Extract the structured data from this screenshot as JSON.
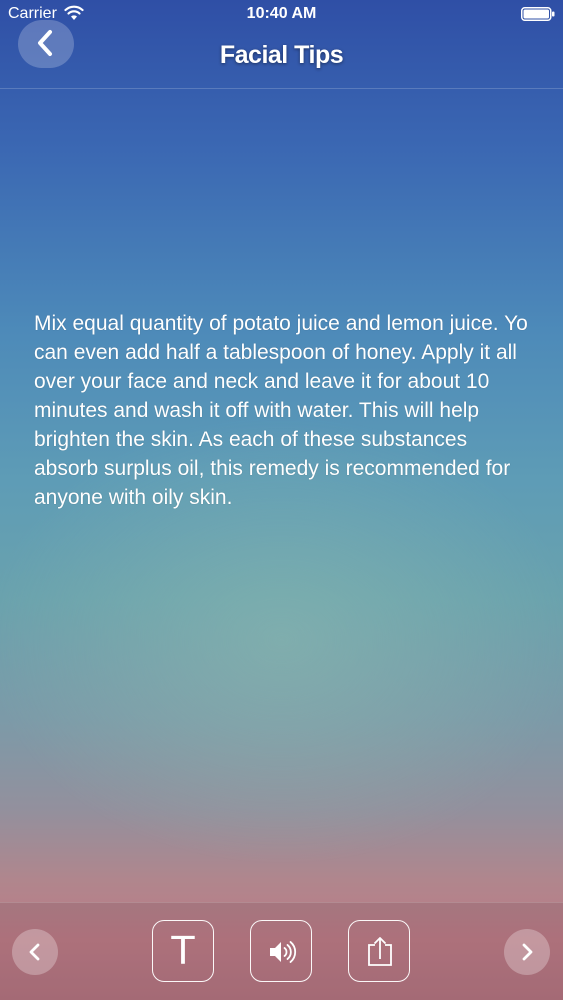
{
  "status_bar": {
    "carrier": "Carrier",
    "time": "10:40 AM",
    "wifi_icon": "wifi-icon",
    "battery_icon": "battery-full-icon"
  },
  "nav": {
    "title": "Facial Tips",
    "back_icon": "chevron-left-icon"
  },
  "content": {
    "tip": "Mix equal quantity of potato juice and lemon juice. Yo can even add half a tablespoon of honey. Apply it all over your face and neck and leave it for about 10 minutes and wash it off with water. This will help brighten the skin. As each of these substances absorb surplus oil, this remedy is recommended for anyone with oily skin."
  },
  "toolbar": {
    "prev_icon": "chevron-left-icon",
    "text_size_glyph": "T",
    "speak_icon": "speaker-icon",
    "share_icon": "share-icon",
    "next_icon": "chevron-right-icon"
  },
  "colors": {
    "text": "#ffffff",
    "gradient_top": "#2f4fa6",
    "gradient_middle": "#6aa2ad",
    "gradient_bottom": "#b3747f"
  }
}
